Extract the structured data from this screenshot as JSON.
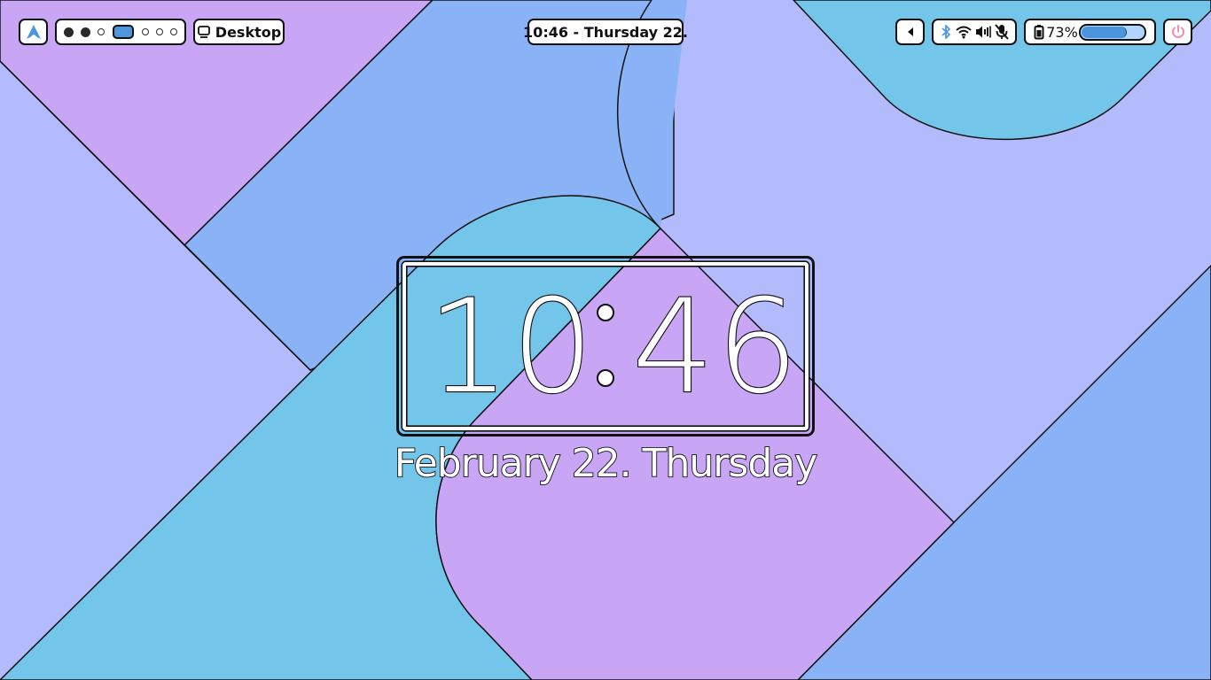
{
  "colors": {
    "lavender": "#b3bbfd",
    "purple": "#c9a5f5",
    "blue": "#89b3f6",
    "sky": "#73c5ea",
    "accent": "#4f96dc",
    "power": "#f08fa8",
    "outline": "#111111"
  },
  "topbar": {
    "launcher_icon": "arch-logo-icon",
    "workspaces": [
      "filled",
      "filled",
      "empty",
      "active",
      "empty",
      "empty",
      "empty"
    ],
    "window_title": "Desktop",
    "window_icon": "monitor-icon",
    "datetime": "10:46 - Thursday 22.",
    "tray_toggle_icon": "triangle-left-icon",
    "tray_icons": [
      "bluetooth-icon",
      "wifi-icon",
      "volume-icon",
      "mic-muted-icon"
    ],
    "battery": {
      "icon": "battery-icon",
      "label": "73%",
      "level": 0.73
    },
    "power_icon": "power-icon"
  },
  "clock": {
    "hours": "10",
    "minutes": "46",
    "date": "February 22. Thursday"
  }
}
